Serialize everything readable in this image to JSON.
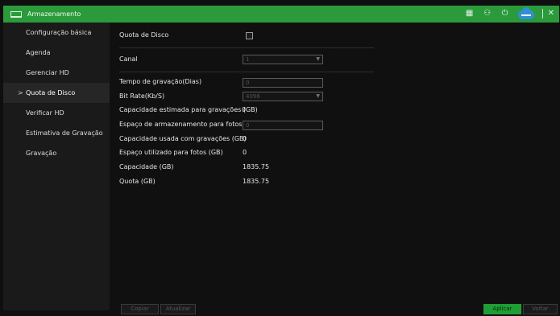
{
  "window": {
    "title": "Armazenamento"
  },
  "sidebar": {
    "items": [
      {
        "label": "Configuração básica",
        "active": false
      },
      {
        "label": "Agenda",
        "active": false
      },
      {
        "label": "Gerenciar HD",
        "active": false
      },
      {
        "label": "Quota de Disco",
        "active": true
      },
      {
        "label": "Verificar HD",
        "active": false
      },
      {
        "label": "Estimativa de Gravação",
        "active": false
      },
      {
        "label": "Gravação",
        "active": false
      }
    ],
    "active_marker": ">"
  },
  "form": {
    "quota_label": "Quota de Disco",
    "quota_enabled": false,
    "channel_label": "Canal",
    "channel_value": "1",
    "record_days_label": "Tempo de gravação(Dias)",
    "record_days_value": "0",
    "bitrate_label": "Bit Rate(Kb/S)",
    "bitrate_value": "4096",
    "est_capacity_label": "Capacidade estimada para gravações (GB)",
    "est_capacity_value": "0",
    "photo_space_label": "Espaço de armazenamento para fotos (GB)",
    "photo_space_value": "0",
    "used_record_label": "Capacidade usada com gravações (GB)",
    "used_record_value": "0",
    "used_photo_label": "Espaço utilizado para fotos (GB)",
    "used_photo_value": "0",
    "capacity_label": "Capacidade (GB)",
    "capacity_value": "1835.75",
    "quota_total_label": "Quota (GB)",
    "quota_total_value": "1835.75"
  },
  "buttons": {
    "copy": "Copiar",
    "refresh": "Atualizar",
    "apply": "Aplicar",
    "back": "Voltar"
  },
  "icons": {
    "window": "storage-icon",
    "toolbar": [
      "grid-icon",
      "user-icon",
      "power-icon",
      "cloud-icon",
      "close-icon"
    ]
  },
  "colors": {
    "titlebar": "#2a9a3b",
    "apply": "#1f9e36",
    "cloud": "#2f8fd8"
  }
}
